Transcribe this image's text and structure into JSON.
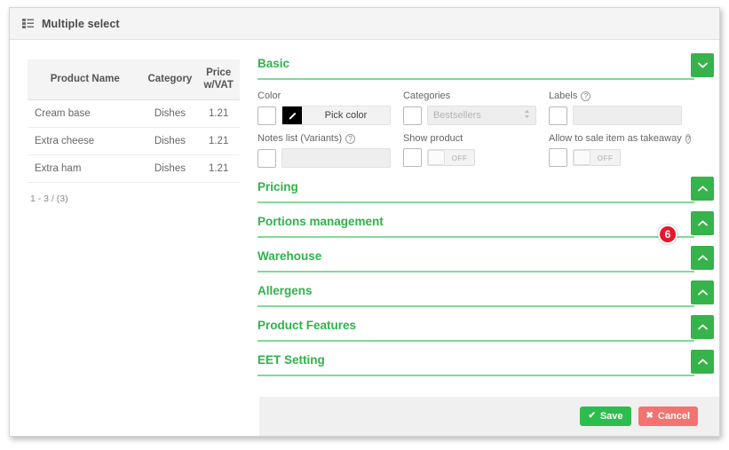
{
  "window": {
    "title": "Multiple select",
    "title_icon": "list-icon"
  },
  "left_panel": {
    "table": {
      "columns": [
        "Product Name",
        "Category",
        "Price w/VAT"
      ],
      "column_price_line1": "Price",
      "column_price_line2": "w/VAT",
      "rows": [
        {
          "name": "Cream base",
          "category": "Dishes",
          "price": "1.21"
        },
        {
          "name": "Extra cheese",
          "category": "Dishes",
          "price": "1.21"
        },
        {
          "name": "Extra ham",
          "category": "Dishes",
          "price": "1.21"
        }
      ]
    },
    "pager": "1 - 3 / (3)"
  },
  "right_panel": {
    "sections": [
      {
        "title": "Basic",
        "expanded": true,
        "chevron": "chevron-down-icon"
      },
      {
        "title": "Pricing",
        "expanded": false,
        "chevron": "chevron-up-icon"
      },
      {
        "title": "Portions management",
        "expanded": false,
        "chevron": "chevron-up-icon"
      },
      {
        "title": "Warehouse",
        "expanded": false,
        "chevron": "chevron-up-icon"
      },
      {
        "title": "Allergens",
        "expanded": false,
        "chevron": "chevron-up-icon"
      },
      {
        "title": "Product Features",
        "expanded": false,
        "chevron": "chevron-up-icon"
      },
      {
        "title": "EET Setting",
        "expanded": false,
        "chevron": "chevron-up-icon"
      }
    ],
    "basic_form": {
      "color": {
        "label": "Color",
        "checkbox_checked": false,
        "button_label": "Pick color",
        "swatch_color": "#000000",
        "swatch_icon": "pencil-icon"
      },
      "categories": {
        "label": "Categories",
        "checkbox_checked": false,
        "value": "Bestsellers",
        "disabled": true,
        "arrow_icon": "sort-arrows-icon"
      },
      "labels": {
        "label": "Labels",
        "help_icon": "question-mark-icon",
        "checkbox_checked": false,
        "value": ""
      },
      "notes_list": {
        "label": "Notes list (Variants)",
        "help_icon": "question-mark-icon",
        "checkbox_checked": false,
        "value": ""
      },
      "show_product": {
        "label": "Show product",
        "checkbox_checked": false,
        "toggle_state": "OFF"
      },
      "takeaway": {
        "label": "Allow to sale item as takeaway",
        "help_icon": "question-mark-icon",
        "checkbox_checked": false,
        "toggle_state": "OFF"
      }
    },
    "badge": {
      "value": "6",
      "color": "#e8182c"
    }
  },
  "footer": {
    "save_label": "Save",
    "save_icon": "check-icon",
    "save_glyph": "✔",
    "cancel_label": "Cancel",
    "cancel_icon": "close-icon",
    "cancel_glyph": "✖"
  },
  "theme": {
    "accent_green": "#2eb34a",
    "button_green": "#36b34b",
    "danger_red": "#e8182c",
    "cancel_red": "#f2736f"
  }
}
